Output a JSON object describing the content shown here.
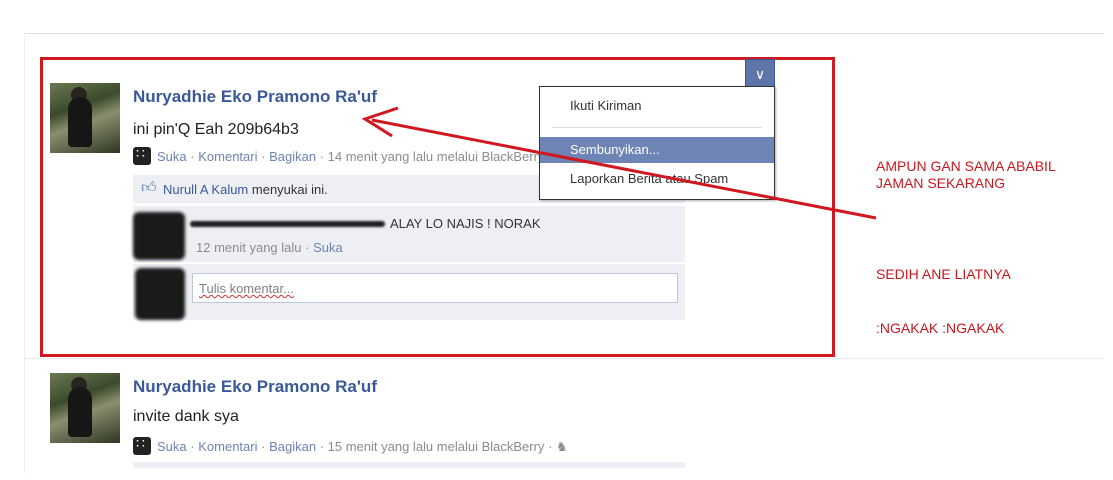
{
  "posts": [
    {
      "author": "Nuryadhie Eko Pramono Ra'uf",
      "message": "ini pin'Q Eah 209b64b3",
      "actions": {
        "like": "Suka",
        "comment": "Komentari",
        "share": "Bagikan"
      },
      "time": "14 menit yang lalu melalui BlackBerry",
      "likers": {
        "name": "Nurull A Kalum",
        "suffix": "menyukai ini."
      },
      "comment": {
        "text": "ALAY LO NAJIS ! NORAK",
        "time": "12 menit yang lalu",
        "like": "Suka"
      },
      "comment_placeholder": "Tulis komentar..."
    },
    {
      "author": "Nuryadhie Eko Pramono Ra'uf",
      "message": "invite dank sya",
      "actions": {
        "like": "Suka",
        "comment": "Komentari",
        "share": "Bagikan"
      },
      "time": "15 menit yang lalu melalui BlackBerry"
    }
  ],
  "menu": {
    "items": [
      "Ikuti Kiriman",
      "Sembunyikan...",
      "Laporkan Berita atau Spam"
    ],
    "highlighted": 1
  },
  "annotations": {
    "line1": "AMPUN GAN SAMA ABABIL",
    "line2": "JAMAN SEKARANG",
    "line3": "SEDIH ANE LIATNYA",
    "line4": ":NGAKAK :NGAKAK"
  },
  "separator": "·",
  "colors": {
    "highlight_box": "#d1171f",
    "link": "#3b5998",
    "menu_highlight": "#6d84b4"
  },
  "icons": {
    "dropdown": "chevron-down-icon",
    "like": "thumbs-up-icon",
    "blackberry": "blackberry-icon",
    "globe": "friends-icon"
  }
}
